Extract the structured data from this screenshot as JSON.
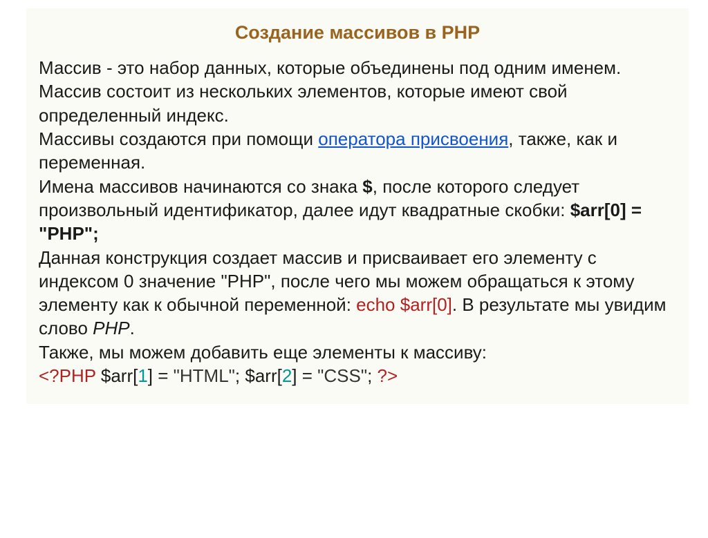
{
  "title": "Создание массивов в PHP",
  "p1_a": "Массив - это набор данных, которые объединены под одним именем. Массив состоит из нескольких элементов, которые имеют свой определенный индекс.",
  "p2_a": "Массивы создаются при помощи ",
  "p2_link": "оператора присвоения",
  "p2_b": ", также, как и переменная.",
  "p3_a": "Имена массивов начинаются со знака ",
  "p3_dollar": "$",
  "p3_b": ", после которого следует произвольный идентификатор, далее идут квадратные скобки: ",
  "p3_code": "$arr[0] = \"PHP\";",
  "p4_a": "Данная конструкция создает массив и присваивает его элементу с индексом 0 значение \"PHP\", после чего мы можем обращаться к этому элементу как к обычной переменной: ",
  "p4_code": "echo $arr[0]",
  "p4_b": ". В результате мы увидим слово ",
  "p4_italic": "PHP",
  "p4_c": ".",
  "p5_a": "Также, мы можем добавить еще элементы к массиву:",
  "p6_open": "<?PHP ",
  "p6_arr1a": "$arr[",
  "p6_arr1idx": "1",
  "p6_arr1b": "] = ",
  "p6_arr1lit": "\"HTML\"",
  "p6_sep1": "; ",
  "p6_arr2a": "$arr[",
  "p6_arr2idx": "2",
  "p6_arr2b": "] = ",
  "p6_arr2lit": "\"CSS\"",
  "p6_sep2": "; ",
  "p6_close": "?>"
}
